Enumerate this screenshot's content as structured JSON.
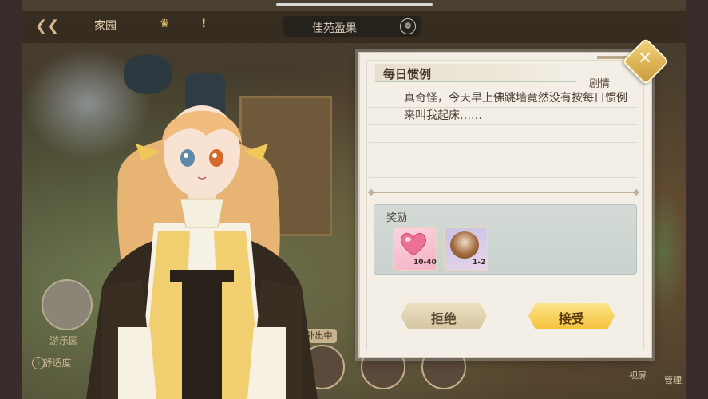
{
  "top_bar": {
    "title": "家园",
    "location": "佳苑盈果",
    "icons": {
      "back": "back-arrow-icon",
      "crown": "crown-icon",
      "alert": "alert-icon",
      "location": "leaf-icon"
    }
  },
  "left_panel": {
    "label": "游乐园",
    "row_label": "舒适度",
    "row_icon": "info-icon"
  },
  "bottom": {
    "status_badge": "外出中"
  },
  "right_panel": {
    "label_1": "视屏",
    "label_2": "管理"
  },
  "dialog": {
    "title": "每日惯例",
    "type": "剧情",
    "description": "真奇怪，今天早上佛跳墙竟然没有按每日惯例来叫我起床……",
    "reward_label": "奖励",
    "rewards": [
      {
        "name": "heart-item",
        "icon": "heart-icon",
        "quantity": "10-40"
      },
      {
        "name": "character-card",
        "icon": "portrait-icon",
        "quantity": "1-2"
      }
    ],
    "reject_label": "拒绝",
    "accept_label": "接受",
    "close_icon": "close-icon"
  },
  "colors": {
    "accept_button": "#f3c23b",
    "reject_button": "#e2d4b1",
    "panel_background": "#f3efe6",
    "reward_box": "#cdd6d2"
  }
}
